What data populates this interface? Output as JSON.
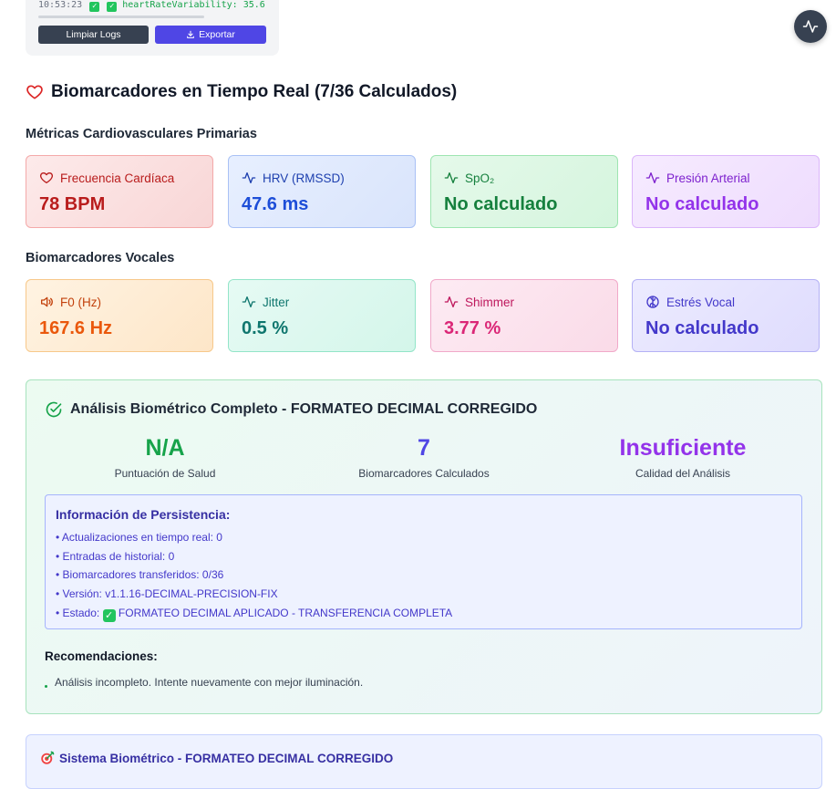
{
  "log": {
    "time": "10:53:23",
    "message": "heartRateVariability: 35.6",
    "clear_label": "Limpiar Logs",
    "export_label": "Exportar"
  },
  "header": {
    "title": "Biomarcadores en Tiempo Real (7/36 Calculados)"
  },
  "cardio": {
    "section_title": "Métricas Cardiovasculares Primarias",
    "cards": [
      {
        "label": "Frecuencia Cardíaca",
        "value": "78 BPM",
        "icon": "heart-icon"
      },
      {
        "label": "HRV (RMSSD)",
        "value": "47.6 ms",
        "icon": "activity-icon"
      },
      {
        "label": "SpO₂",
        "value": "No calculado",
        "icon": "activity-icon"
      },
      {
        "label": "Presión Arterial",
        "value": "No calculado",
        "icon": "activity-icon"
      }
    ]
  },
  "vocal": {
    "section_title": "Biomarcadores Vocales",
    "cards": [
      {
        "label": "F0 (Hz)",
        "value": "167.6 Hz",
        "icon": "volume-icon"
      },
      {
        "label": "Jitter",
        "value": "0.5 %",
        "icon": "activity-icon"
      },
      {
        "label": "Shimmer",
        "value": "3.77 %",
        "icon": "activity-icon"
      },
      {
        "label": "Estrés Vocal",
        "value": "No calculado",
        "icon": "brain-icon"
      }
    ]
  },
  "analysis": {
    "title": "Análisis Biométrico Completo - FORMATEO DECIMAL CORREGIDO",
    "stats": [
      {
        "value": "N/A",
        "label": "Puntuación de Salud"
      },
      {
        "value": "7",
        "label": "Biomarcadores Calculados"
      },
      {
        "value": "Insuficiente",
        "label": "Calidad del Análisis"
      }
    ],
    "persistence": {
      "title": "Información de Persistencia:",
      "items": [
        "• Actualizaciones en tiempo real: 0",
        "• Entradas de historial: 0",
        "• Biomarcadores transferidos: 0/36",
        "• Versión: v1.1.16-DECIMAL-PRECISION-FIX",
        "• Estado: ",
        "FORMATEO DECIMAL APLICADO - TRANSFERENCIA COMPLETA"
      ]
    },
    "recommendations_title": "Recomendaciones:",
    "recommendations": [
      "Análisis incompleto. Intente nuevamente con mejor iluminación."
    ]
  },
  "system": {
    "title": "Sistema Biométrico - FORMATEO DECIMAL CORREGIDO"
  },
  "colors": {
    "accent_export": "#4f46e5",
    "heart": "#dc2626",
    "success": "#16a34a",
    "stat_na": "#16a34a",
    "stat_count": "#4f46e5",
    "stat_quality": "#9333ea"
  }
}
